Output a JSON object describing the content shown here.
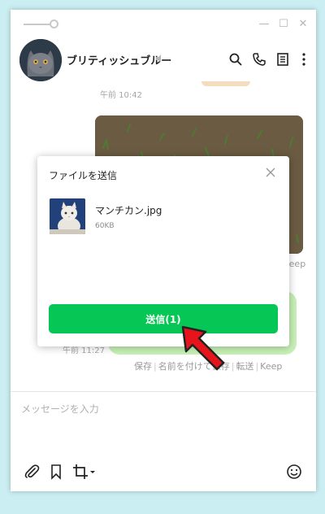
{
  "window": {
    "controls": {
      "minimize": "—",
      "maximize": "☐",
      "close": "✕"
    }
  },
  "header": {
    "name": "ブリティッシュブルー",
    "icons": [
      "search-icon",
      "phone-icon",
      "notes-icon",
      "more-icon"
    ]
  },
  "chat": {
    "time_first": "午前 10:42",
    "time_second": "午前 11:27",
    "actions_top": {
      "keep": "Keep"
    },
    "actions_bottom": {
      "save": "保存",
      "save_named": "名前を付けて保存",
      "forward": "転送",
      "keep": "Keep"
    }
  },
  "composer": {
    "placeholder": "メッセージを入力",
    "icons": [
      "attach-icon",
      "bookmark-icon",
      "crop-icon",
      "emoji-icon"
    ]
  },
  "dialog": {
    "title": "ファイルを送信",
    "file_name": "マンチカン.jpg",
    "file_size": "60KB",
    "send_label": "送信(1)"
  },
  "colors": {
    "accent": "#06c755",
    "bubble": "#c7f0b6",
    "arrow": "#e8141b",
    "background": "#cbeef2"
  }
}
